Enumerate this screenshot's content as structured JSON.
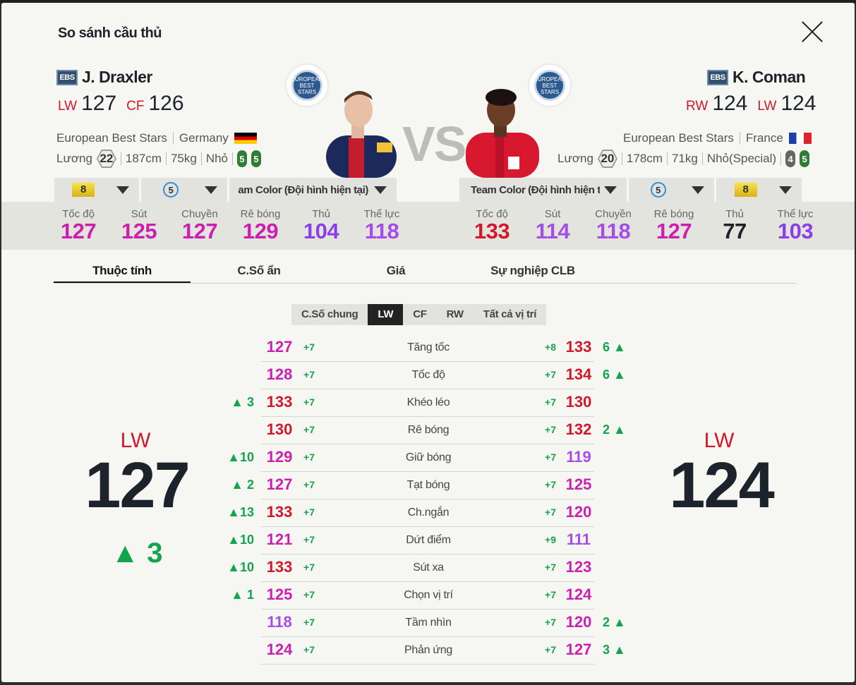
{
  "title": "So sánh cầu thủ",
  "vs": "VS",
  "colors": {
    "pink": "#cc1fb0",
    "purple": "#9a3df0",
    "red": "#d2182b",
    "green": "#14a44d"
  },
  "left": {
    "badge": "EBS",
    "name": "J. Draxler",
    "positions": [
      {
        "pos": "LW",
        "ovr": "127"
      },
      {
        "pos": "CF",
        "ovr": "126"
      }
    ],
    "club": "European Best Stars",
    "nation": "Germany",
    "salary_label": "Lương",
    "salary": "22",
    "height": "187cm",
    "weight": "75kg",
    "body": "Nhỏ",
    "foot_left": "5",
    "foot_right": "5",
    "dd_level": "8",
    "dd_trait": "5",
    "dd_team": "am Color (Đội hình hiện tại)",
    "stats": [
      {
        "k": "Tốc độ",
        "v": "127",
        "c": "#cc1fb0"
      },
      {
        "k": "Sút",
        "v": "125",
        "c": "#cc1fb0"
      },
      {
        "k": "Chuyền",
        "v": "127",
        "c": "#cc1fb0"
      },
      {
        "k": "Rê bóng",
        "v": "129",
        "c": "#cc1fb0"
      },
      {
        "k": "Thủ",
        "v": "104",
        "c": "#8a3de8"
      },
      {
        "k": "Thể lực",
        "v": "118",
        "c": "#a64de8"
      }
    ],
    "big_pos": "LW",
    "big_ovr": "127",
    "big_up": "▲ 3"
  },
  "right": {
    "badge": "EBS",
    "name": "K. Coman",
    "positions": [
      {
        "pos": "RW",
        "ovr": "124"
      },
      {
        "pos": "LW",
        "ovr": "124"
      }
    ],
    "club": "European Best Stars",
    "nation": "France",
    "salary_label": "Lương",
    "salary": "20",
    "height": "178cm",
    "weight": "71kg",
    "body": "Nhỏ(Special)",
    "foot_left": "4",
    "foot_right": "5",
    "dd_level": "8",
    "dd_trait": "5",
    "dd_team": "Team Color (Đội hình hiện t",
    "stats": [
      {
        "k": "Tốc độ",
        "v": "133",
        "c": "#d2182b"
      },
      {
        "k": "Sút",
        "v": "114",
        "c": "#a64de8"
      },
      {
        "k": "Chuyền",
        "v": "118",
        "c": "#a64de8"
      },
      {
        "k": "Rê bóng",
        "v": "127",
        "c": "#cc1fb0"
      },
      {
        "k": "Thủ",
        "v": "77",
        "c": "#1d232b"
      },
      {
        "k": "Thể lực",
        "v": "103",
        "c": "#8a3de8"
      }
    ],
    "big_pos": "LW",
    "big_ovr": "124"
  },
  "tabs": [
    "Thuộc tính",
    "C.Số ẩn",
    "Giá",
    "Sự nghiệp CLB"
  ],
  "subtabs": [
    "C.Số chung",
    "LW",
    "CF",
    "RW",
    "Tất cả vị trí"
  ],
  "attributes": [
    {
      "name": "Tăng tốc",
      "lup": "",
      "lv": "127",
      "lc": "#cc1fb0",
      "lb": "+7",
      "rb": "+8",
      "rv": "133",
      "rc": "#d2182b",
      "rup": "6 ▲"
    },
    {
      "name": "Tốc độ",
      "lup": "",
      "lv": "128",
      "lc": "#cc1fb0",
      "lb": "+7",
      "rb": "+7",
      "rv": "134",
      "rc": "#d2182b",
      "rup": "6 ▲"
    },
    {
      "name": "Khéo léo",
      "lup": "▲ 3",
      "lv": "133",
      "lc": "#d2182b",
      "lb": "+7",
      "rb": "+7",
      "rv": "130",
      "rc": "#d2182b",
      "rup": ""
    },
    {
      "name": "Rê bóng",
      "lup": "",
      "lv": "130",
      "lc": "#d2182b",
      "lb": "+7",
      "rb": "+7",
      "rv": "132",
      "rc": "#d2182b",
      "rup": "2 ▲"
    },
    {
      "name": "Giữ bóng",
      "lup": "▲10",
      "lv": "129",
      "lc": "#cc1fb0",
      "lb": "+7",
      "rb": "+7",
      "rv": "119",
      "rc": "#a64de8",
      "rup": ""
    },
    {
      "name": "Tạt bóng",
      "lup": "▲ 2",
      "lv": "127",
      "lc": "#cc1fb0",
      "lb": "+7",
      "rb": "+7",
      "rv": "125",
      "rc": "#cc1fb0",
      "rup": ""
    },
    {
      "name": "Ch.ngắn",
      "lup": "▲13",
      "lv": "133",
      "lc": "#d2182b",
      "lb": "+7",
      "rb": "+7",
      "rv": "120",
      "rc": "#cc1fb0",
      "rup": ""
    },
    {
      "name": "Dứt điểm",
      "lup": "▲10",
      "lv": "121",
      "lc": "#cc1fb0",
      "lb": "+7",
      "rb": "+9",
      "rv": "111",
      "rc": "#a64de8",
      "rup": ""
    },
    {
      "name": "Sút xa",
      "lup": "▲10",
      "lv": "133",
      "lc": "#d2182b",
      "lb": "+7",
      "rb": "+7",
      "rv": "123",
      "rc": "#cc1fb0",
      "rup": ""
    },
    {
      "name": "Chọn vị trí",
      "lup": "▲ 1",
      "lv": "125",
      "lc": "#cc1fb0",
      "lb": "+7",
      "rb": "+7",
      "rv": "124",
      "rc": "#cc1fb0",
      "rup": ""
    },
    {
      "name": "Tầm nhìn",
      "lup": "",
      "lv": "118",
      "lc": "#a64de8",
      "lb": "+7",
      "rb": "+7",
      "rv": "120",
      "rc": "#cc1fb0",
      "rup": "2 ▲"
    },
    {
      "name": "Phản ứng",
      "lup": "",
      "lv": "124",
      "lc": "#cc1fb0",
      "lb": "+7",
      "rb": "+7",
      "rv": "127",
      "rc": "#cc1fb0",
      "rup": "3 ▲"
    }
  ]
}
